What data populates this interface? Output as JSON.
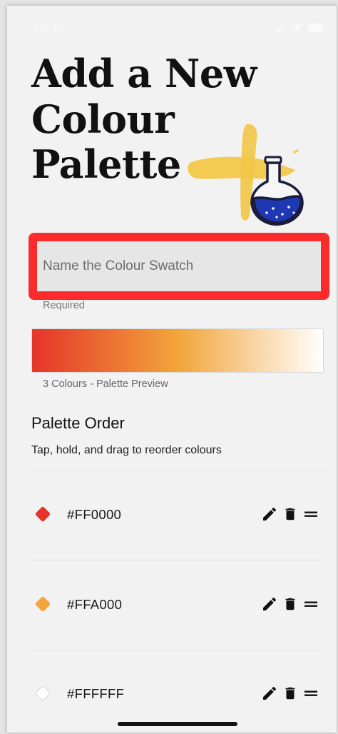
{
  "status_bar": {
    "time": "10:40"
  },
  "header": {
    "title": "Add a New Colour Palette"
  },
  "name_field": {
    "placeholder": "Name the Colour Swatch",
    "value": "",
    "hint": "Required"
  },
  "preview": {
    "caption": "3 Colours - Palette Preview",
    "gradient_colors": [
      "#e5352a",
      "#f2a53a",
      "#ffffff"
    ]
  },
  "palette_order": {
    "title": "Palette Order",
    "subtitle": "Tap, hold, and drag to reorder colours"
  },
  "colours": [
    {
      "hex": "#FF0000",
      "swatch": "#e5352a"
    },
    {
      "hex": "#FFA000",
      "swatch": "#f2a53a"
    },
    {
      "hex": "#FFFFFF",
      "swatch": "#ffffff"
    }
  ],
  "icons": {
    "edit": "pencil-icon",
    "delete": "trash-icon",
    "reorder": "drag-handle-icon"
  },
  "colors": {
    "highlight_border": "#fc2b2b",
    "flask_liquid": "#1d38b0",
    "paint_stroke": "#f2c84a"
  }
}
